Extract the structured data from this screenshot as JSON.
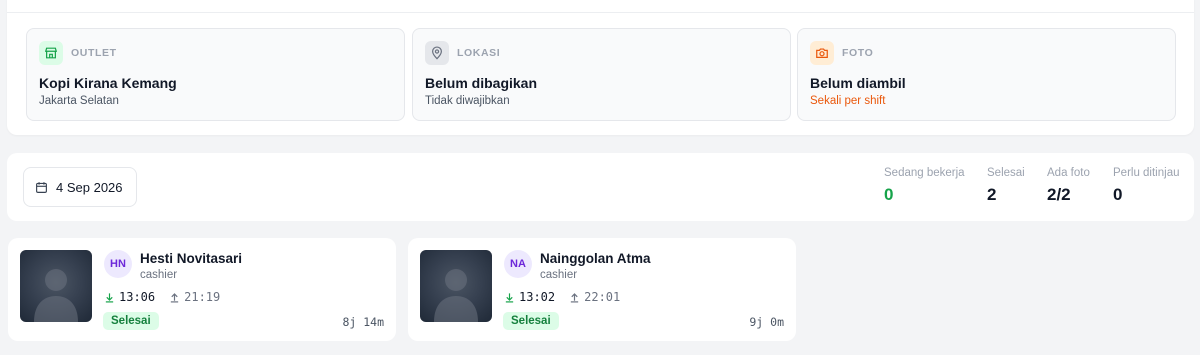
{
  "info_cards": [
    {
      "label": "OUTLET",
      "value": "Kopi Kirana Kemang",
      "sub": "Jakarta Selatan",
      "icon": "store-icon",
      "icon_bg": "#dcfce7",
      "icon_color": "#16a34a"
    },
    {
      "label": "LOKASI",
      "value": "Belum dibagikan",
      "sub": "Tidak diwajibkan",
      "icon": "map-pin-icon",
      "icon_bg": "#e5e7eb",
      "icon_color": "#6b7280"
    },
    {
      "label": "FOTO",
      "value": "Belum diambil",
      "sub": "Sekali per shift",
      "icon": "camera-icon",
      "icon_bg": "#ffedd5",
      "icon_color": "#ea580c"
    }
  ],
  "date_picker": {
    "value": "4 Sep 2026",
    "icon": "calendar-icon"
  },
  "stats": [
    {
      "label": "Sedang bekerja",
      "value": "0"
    },
    {
      "label": "Selesai",
      "value": "2"
    },
    {
      "label": "Ada foto",
      "value": "2/2"
    },
    {
      "label": "Perlu ditinjau",
      "value": "0"
    }
  ],
  "employees": [
    {
      "initials": "HN",
      "name": "Hesti Novitasari",
      "role": "cashier",
      "clock_in": "13:06",
      "clock_out": "21:19",
      "status": "Selesai",
      "duration": "8j 14m"
    },
    {
      "initials": "NA",
      "name": "Nainggolan Atma",
      "role": "cashier",
      "clock_in": "13:02",
      "clock_out": "22:01",
      "status": "Selesai",
      "duration": "9j 0m"
    }
  ],
  "colors": {
    "accent_green": "#16a34a",
    "warning_orange": "#ea580c",
    "avatar_purple": "#6d28d9"
  }
}
